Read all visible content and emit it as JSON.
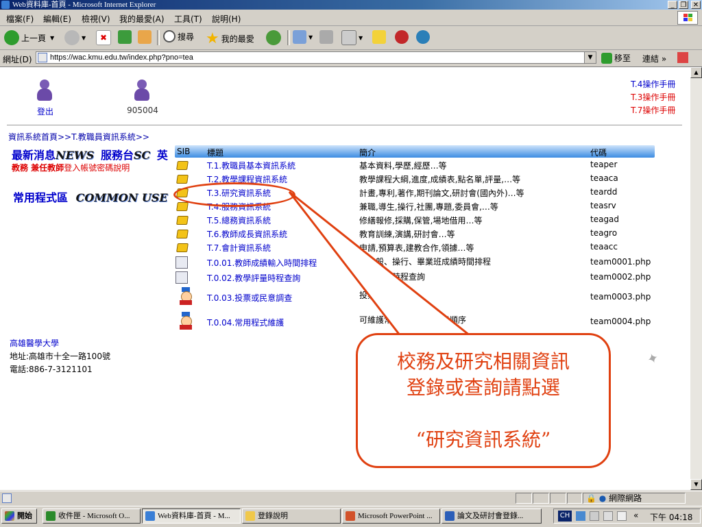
{
  "window": {
    "title": "Web資料庫-首頁 - Microsoft Internet Explorer"
  },
  "menu": [
    "檔案(F)",
    "編輯(E)",
    "檢視(V)",
    "我的最愛(A)",
    "工具(T)",
    "說明(H)"
  ],
  "toolbar": {
    "back": "上一頁",
    "search": "搜尋",
    "favorites": "我的最愛"
  },
  "address": {
    "label": "網址(D)",
    "url": "https://wac.kmu.edu.tw/index.php?pno=tea",
    "go": "移至",
    "links": "連結"
  },
  "header": {
    "logout": "登出",
    "user_id": "905004",
    "manuals": [
      {
        "label": "T.4操作手冊",
        "color": "#0000cc"
      },
      {
        "label": "T.3操作手冊",
        "color": "#dd0000"
      },
      {
        "label": "T.7操作手冊",
        "color": "#dd0000"
      }
    ]
  },
  "breadcrumb": "資訊系統首頁>>T.教職員資訊系統>>",
  "left": {
    "news_cn": "最新消息",
    "news_en": "NEWS",
    "service_cn": "服務台",
    "service_en": "SC",
    "lang": "英",
    "notice_bold": "教務 兼任教師",
    "notice_rest": "登入帳號密碼說明",
    "common_cn": "常用程式區",
    "common_en": "COMMON USE"
  },
  "table": {
    "headers": {
      "sib": "SIB",
      "title": "標題",
      "intro": "簡介",
      "code": "代碼"
    },
    "rows": [
      {
        "icon": "book",
        "title": "T.1.教職員基本資訊系統",
        "intro": "基本資料,學歷,經歷…等",
        "code": "teaper"
      },
      {
        "icon": "book",
        "title": "T.2.教學課程資訊系統",
        "intro": "教學課程大綱,進度,成績表,點名單,評量,…等",
        "code": "teaaca"
      },
      {
        "icon": "book",
        "title": "T.3.研究資訊系統",
        "intro": "計畫,專利,著作,期刊論文,研討會(國內外)…等",
        "code": "teardd"
      },
      {
        "icon": "book",
        "title": "T.4.服務資訊系統",
        "intro": "兼職,導生,操行,社團,專題,委員會,…等",
        "code": "teasrv"
      },
      {
        "icon": "book",
        "title": "T.5.總務資訊系統",
        "intro": "修繕報修,採購,保管,場地借用…等",
        "code": "teagad"
      },
      {
        "icon": "book",
        "title": "T.6.教師成長資訊系統",
        "intro": "教育訓練,演講,研討會…等",
        "code": "teagro"
      },
      {
        "icon": "book",
        "title": "T.7.會計資訊系統",
        "intro": "申請,預算表,建教合作,領據…等",
        "code": "teaacc"
      },
      {
        "icon": "doc",
        "title": "T.0.01.教師成績輸入時間排程",
        "intro": "含一般、操行、畢業班成績時間排程",
        "code": "team0001.php"
      },
      {
        "icon": "doc",
        "title": "T.0.02.教學評量時程查詢",
        "intro": "教學評量時程查詢",
        "code": "team0002.php"
      },
      {
        "icon": "clown",
        "title": "T.0.03.投票或民意調查",
        "intro": "投票或民意調查",
        "code": "team0003.php"
      },
      {
        "icon": "clown",
        "title": "T.0.04.常用程式維護",
        "intro": "可維護常用程式區之顯示順序",
        "code": "team0004.php"
      }
    ]
  },
  "footer": {
    "school": "高雄醫學大學",
    "address": "地址:高雄市十全一路100號",
    "phone": "電話:886-7-3121101"
  },
  "callout": {
    "line1": "校務及研究相關資訊",
    "line2": "登錄或查詢請點選",
    "line3": "“研究資訊系統”"
  },
  "status": {
    "zone": "網際網路"
  },
  "taskbar": {
    "start": "開始",
    "tasks": [
      "收件匣 - Microsoft O...",
      "Web資料庫-首頁 - M...",
      "登錄說明",
      "Microsoft PowerPoint ...",
      "論文及研討會登錄..."
    ],
    "ime": "CH",
    "clock": "下午 04:18"
  }
}
